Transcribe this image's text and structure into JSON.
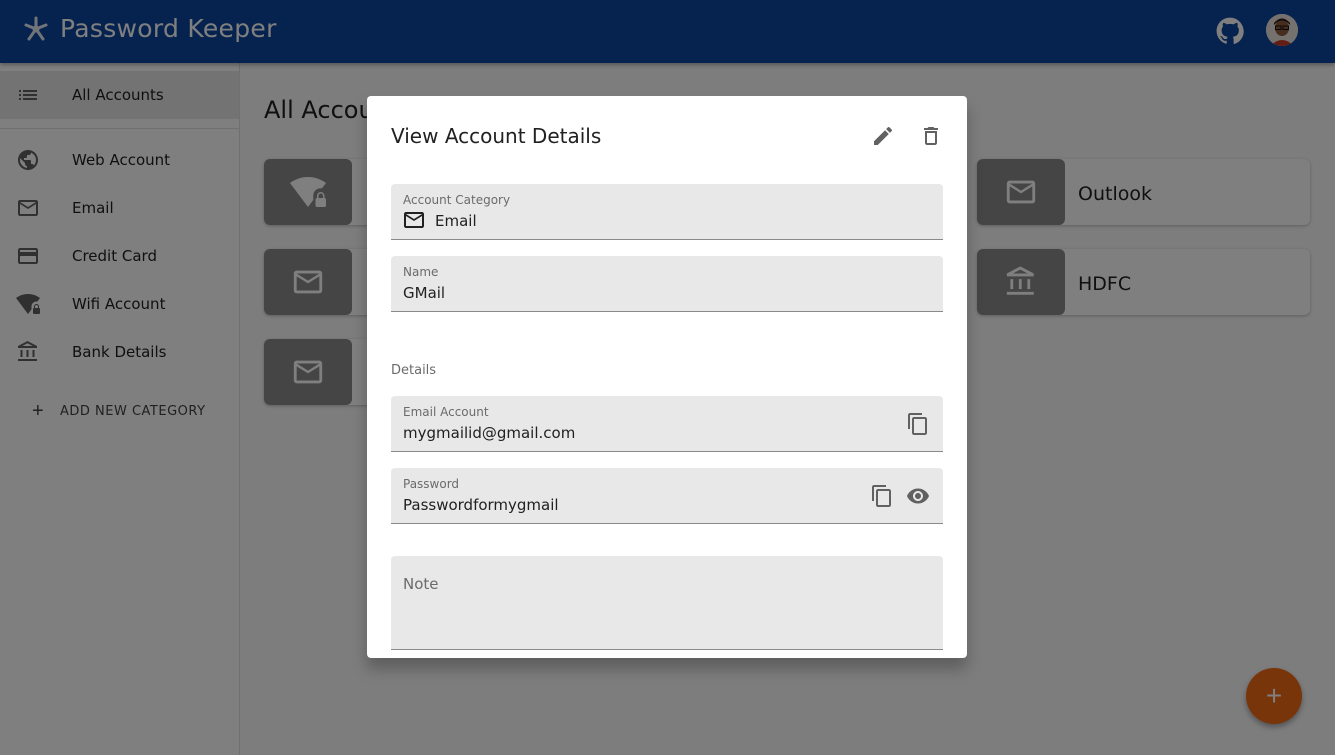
{
  "app": {
    "title": "Password Keeper"
  },
  "sidebar": {
    "items": [
      {
        "label": "All Accounts",
        "icon": "list-icon"
      },
      {
        "label": "Web Account",
        "icon": "globe-icon"
      },
      {
        "label": "Email",
        "icon": "mail-icon"
      },
      {
        "label": "Credit Card",
        "icon": "credit-card-icon"
      },
      {
        "label": "Wifi Account",
        "icon": "wifi-lock-icon"
      },
      {
        "label": "Bank Details",
        "icon": "bank-icon"
      }
    ],
    "add_category": "ADD NEW CATEGORY"
  },
  "main": {
    "title": "All Accounts",
    "cards": [
      {
        "title": "",
        "icon": "wifi-lock-icon"
      },
      {
        "title": "",
        "icon": "mail-icon"
      },
      {
        "title": "",
        "icon": "mail-icon"
      },
      {
        "title": "Outlook",
        "icon": "mail-icon"
      },
      {
        "title": "HDFC",
        "icon": "bank-icon"
      }
    ]
  },
  "dialog": {
    "title": "View Account Details",
    "category": {
      "label": "Account Category",
      "value": "Email"
    },
    "name": {
      "label": "Name",
      "value": "GMail"
    },
    "details_label": "Details",
    "email": {
      "label": "Email Account",
      "value": "mygmailid@gmail.com"
    },
    "password": {
      "label": "Password",
      "value": "Passwordformygmail"
    },
    "note": {
      "label": "Note",
      "value": ""
    }
  },
  "colors": {
    "appbar": "#0d47a1",
    "fab": "#f26a14",
    "card_thumb": "#8a8a8a"
  }
}
